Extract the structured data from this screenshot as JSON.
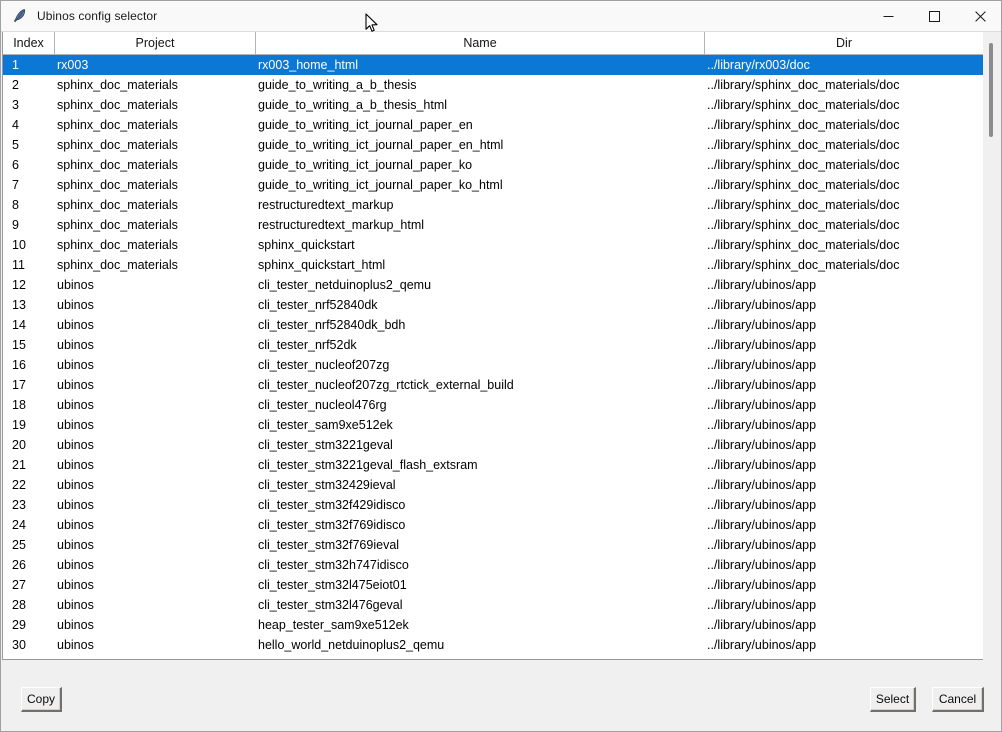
{
  "window": {
    "title": "Ubinos config selector",
    "icon": "feather-icon",
    "controls": [
      {
        "name": "minimize-button",
        "glyph": "minimize-icon"
      },
      {
        "name": "maximize-button",
        "glyph": "maximize-icon"
      },
      {
        "name": "close-button",
        "glyph": "close-icon"
      }
    ]
  },
  "table": {
    "columns": [
      {
        "key": "index",
        "label": "Index"
      },
      {
        "key": "project",
        "label": "Project"
      },
      {
        "key": "name",
        "label": "Name"
      },
      {
        "key": "dir",
        "label": "Dir"
      }
    ],
    "selected_index": 1,
    "selection_color": "#0a78d4",
    "rows": [
      {
        "index": "1",
        "project": "rx003",
        "name": "rx003_home_html",
        "dir": "../library/rx003/doc"
      },
      {
        "index": "2",
        "project": "sphinx_doc_materials",
        "name": "guide_to_writing_a_b_thesis",
        "dir": "../library/sphinx_doc_materials/doc"
      },
      {
        "index": "3",
        "project": "sphinx_doc_materials",
        "name": "guide_to_writing_a_b_thesis_html",
        "dir": "../library/sphinx_doc_materials/doc"
      },
      {
        "index": "4",
        "project": "sphinx_doc_materials",
        "name": "guide_to_writing_ict_journal_paper_en",
        "dir": "../library/sphinx_doc_materials/doc"
      },
      {
        "index": "5",
        "project": "sphinx_doc_materials",
        "name": "guide_to_writing_ict_journal_paper_en_html",
        "dir": "../library/sphinx_doc_materials/doc"
      },
      {
        "index": "6",
        "project": "sphinx_doc_materials",
        "name": "guide_to_writing_ict_journal_paper_ko",
        "dir": "../library/sphinx_doc_materials/doc"
      },
      {
        "index": "7",
        "project": "sphinx_doc_materials",
        "name": "guide_to_writing_ict_journal_paper_ko_html",
        "dir": "../library/sphinx_doc_materials/doc"
      },
      {
        "index": "8",
        "project": "sphinx_doc_materials",
        "name": "restructuredtext_markup",
        "dir": "../library/sphinx_doc_materials/doc"
      },
      {
        "index": "9",
        "project": "sphinx_doc_materials",
        "name": "restructuredtext_markup_html",
        "dir": "../library/sphinx_doc_materials/doc"
      },
      {
        "index": "10",
        "project": "sphinx_doc_materials",
        "name": "sphinx_quickstart",
        "dir": "../library/sphinx_doc_materials/doc"
      },
      {
        "index": "11",
        "project": "sphinx_doc_materials",
        "name": "sphinx_quickstart_html",
        "dir": "../library/sphinx_doc_materials/doc"
      },
      {
        "index": "12",
        "project": "ubinos",
        "name": "cli_tester_netduinoplus2_qemu",
        "dir": "../library/ubinos/app"
      },
      {
        "index": "13",
        "project": "ubinos",
        "name": "cli_tester_nrf52840dk",
        "dir": "../library/ubinos/app"
      },
      {
        "index": "14",
        "project": "ubinos",
        "name": "cli_tester_nrf52840dk_bdh",
        "dir": "../library/ubinos/app"
      },
      {
        "index": "15",
        "project": "ubinos",
        "name": "cli_tester_nrf52dk",
        "dir": "../library/ubinos/app"
      },
      {
        "index": "16",
        "project": "ubinos",
        "name": "cli_tester_nucleof207zg",
        "dir": "../library/ubinos/app"
      },
      {
        "index": "17",
        "project": "ubinos",
        "name": "cli_tester_nucleof207zg_rtctick_external_build",
        "dir": "../library/ubinos/app"
      },
      {
        "index": "18",
        "project": "ubinos",
        "name": "cli_tester_nucleol476rg",
        "dir": "../library/ubinos/app"
      },
      {
        "index": "19",
        "project": "ubinos",
        "name": "cli_tester_sam9xe512ek",
        "dir": "../library/ubinos/app"
      },
      {
        "index": "20",
        "project": "ubinos",
        "name": "cli_tester_stm3221geval",
        "dir": "../library/ubinos/app"
      },
      {
        "index": "21",
        "project": "ubinos",
        "name": "cli_tester_stm3221geval_flash_extsram",
        "dir": "../library/ubinos/app"
      },
      {
        "index": "22",
        "project": "ubinos",
        "name": "cli_tester_stm32429ieval",
        "dir": "../library/ubinos/app"
      },
      {
        "index": "23",
        "project": "ubinos",
        "name": "cli_tester_stm32f429idisco",
        "dir": "../library/ubinos/app"
      },
      {
        "index": "24",
        "project": "ubinos",
        "name": "cli_tester_stm32f769idisco",
        "dir": "../library/ubinos/app"
      },
      {
        "index": "25",
        "project": "ubinos",
        "name": "cli_tester_stm32f769ieval",
        "dir": "../library/ubinos/app"
      },
      {
        "index": "26",
        "project": "ubinos",
        "name": "cli_tester_stm32h747idisco",
        "dir": "../library/ubinos/app"
      },
      {
        "index": "27",
        "project": "ubinos",
        "name": "cli_tester_stm32l475eiot01",
        "dir": "../library/ubinos/app"
      },
      {
        "index": "28",
        "project": "ubinos",
        "name": "cli_tester_stm32l476geval",
        "dir": "../library/ubinos/app"
      },
      {
        "index": "29",
        "project": "ubinos",
        "name": "heap_tester_sam9xe512ek",
        "dir": "../library/ubinos/app"
      },
      {
        "index": "30",
        "project": "ubinos",
        "name": "hello_world_netduinoplus2_qemu",
        "dir": "../library/ubinos/app"
      }
    ]
  },
  "buttons": {
    "copy": "Copy",
    "select": "Select",
    "cancel": "Cancel"
  }
}
